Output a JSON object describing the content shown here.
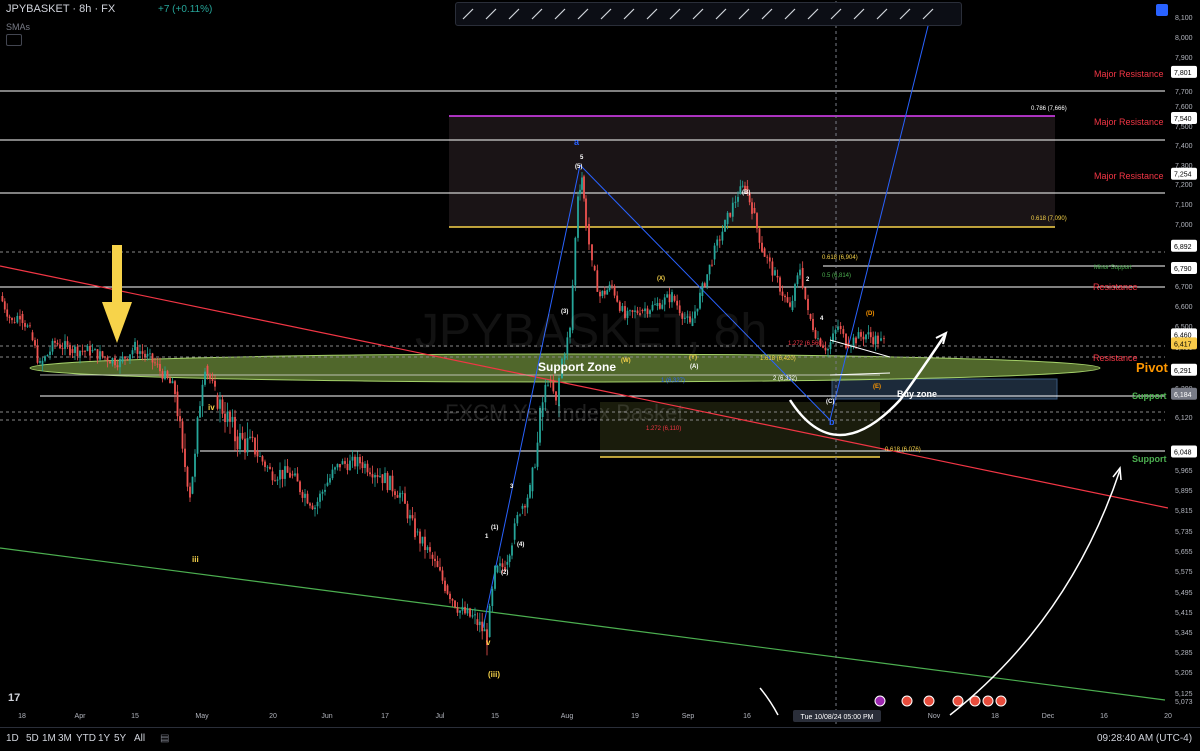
{
  "header": {
    "symbol": "JPYBASKET · 8h · FX",
    "change": "+7 (+0.11%)",
    "indicator": "SMAs"
  },
  "toolbar": {
    "icons": [
      "trend-line",
      "horizontal-line",
      "horizontal-ray",
      "vertical-line",
      "parallel-channel",
      "fib-retracement",
      "pitchfork",
      "elliott-wave",
      "xabcd-pattern",
      "abcd-pattern",
      "head-shoulders",
      "long-position",
      "range",
      "text",
      "rectangle",
      "circle",
      "path",
      "brush",
      "flag",
      "note",
      "ellipse"
    ]
  },
  "watermark": {
    "symbol": "JPYBASKET, 8h",
    "description": "FXCM Yen Index Basket"
  },
  "chart_data": {
    "type": "candlestick",
    "symbol": "JPYBASKET",
    "timeframe": "8h",
    "y_axis": {
      "ticks": [
        "8,100",
        "8,000",
        "7,900",
        "7,800",
        "7,700",
        "7,600",
        "7,500",
        "7,400",
        "7,300",
        "7,200",
        "7,100",
        "7,000",
        "6,900",
        "6,800",
        "6,700",
        "6,600",
        "6,500",
        "6,400",
        "6,300",
        "6,200",
        "6,120",
        "6,050",
        "5,965",
        "5,895",
        "5,815",
        "5,735",
        "5,655",
        "5,575",
        "5,495",
        "5,415",
        "5,345",
        "5,285",
        "5,205",
        "5,125",
        "5,073"
      ],
      "tick_values": [
        8100,
        8000,
        7900,
        7800,
        7700,
        7600,
        7500,
        7400,
        7300,
        7200,
        7100,
        7000,
        6900,
        6800,
        6700,
        6600,
        6500,
        6400,
        6300,
        6200,
        6120,
        6050,
        5965,
        5895,
        5815,
        5735,
        5655,
        5575,
        5495,
        5415,
        5345,
        5285,
        5205,
        5125,
        5073
      ],
      "badges": [
        {
          "text": "7,801",
          "value": 7801,
          "color": "#ffffff"
        },
        {
          "text": "7,540",
          "value": 7540,
          "color": "#ffffff"
        },
        {
          "text": "7,254",
          "value": 7254,
          "color": "#ffffff"
        },
        {
          "text": "6,892",
          "value": 6892,
          "color": "#ffffff"
        },
        {
          "text": "6,790",
          "value": 6790,
          "color": "#ffffff"
        },
        {
          "text": "6,460",
          "value": 6460,
          "color": "#ffffff"
        },
        {
          "text": "6,417",
          "value": 6417,
          "color": "#f7c948"
        },
        {
          "text": "6,291",
          "value": 6291,
          "color": "#ffffff"
        },
        {
          "text": "6,184",
          "value": 6184,
          "color": "#787b86"
        },
        {
          "text": "6,048",
          "value": 6048,
          "color": "#ffffff"
        }
      ]
    },
    "x_axis": {
      "ticks": [
        "18",
        "Apr",
        "15",
        "May",
        "20",
        "Jun",
        "17",
        "Jul",
        "15",
        "Aug",
        "19",
        "Sep",
        "16",
        "Nov",
        "18",
        "Dec",
        "16",
        "20"
      ],
      "crosshair_label": "Tue 10/08/24  05:00 PM"
    },
    "price_path": [
      [
        0,
        6650
      ],
      [
        12,
        6520
      ],
      [
        20,
        6560
      ],
      [
        30,
        6470
      ],
      [
        40,
        6310
      ],
      [
        55,
        6420
      ],
      [
        70,
        6390
      ],
      [
        90,
        6380
      ],
      [
        105,
        6350
      ],
      [
        120,
        6330
      ],
      [
        135,
        6400
      ],
      [
        155,
        6320
      ],
      [
        175,
        6190
      ],
      [
        190,
        5880
      ],
      [
        205,
        6310
      ],
      [
        215,
        6180
      ],
      [
        235,
        6080
      ],
      [
        255,
        6050
      ],
      [
        270,
        5960
      ],
      [
        290,
        5950
      ],
      [
        315,
        5830
      ],
      [
        325,
        5910
      ],
      [
        340,
        5990
      ],
      [
        360,
        6000
      ],
      [
        380,
        5950
      ],
      [
        400,
        5880
      ],
      [
        415,
        5730
      ],
      [
        430,
        5640
      ],
      [
        445,
        5520
      ],
      [
        460,
        5420
      ],
      [
        475,
        5390
      ],
      [
        487,
        5330
      ],
      [
        495,
        5570
      ],
      [
        505,
        5600
      ],
      [
        512,
        5700
      ],
      [
        520,
        5820
      ],
      [
        530,
        5890
      ],
      [
        540,
        6120
      ],
      [
        548,
        6240
      ],
      [
        556,
        6150
      ],
      [
        562,
        6340
      ],
      [
        570,
        6480
      ],
      [
        578,
        7150
      ],
      [
        582,
        7240
      ],
      [
        586,
        7000
      ],
      [
        592,
        6800
      ],
      [
        600,
        6650
      ],
      [
        612,
        6700
      ],
      [
        625,
        6540
      ],
      [
        640,
        6580
      ],
      [
        655,
        6600
      ],
      [
        672,
        6650
      ],
      [
        690,
        6500
      ],
      [
        700,
        6650
      ],
      [
        712,
        6830
      ],
      [
        725,
        7000
      ],
      [
        738,
        7150
      ],
      [
        745,
        7190
      ],
      [
        752,
        7080
      ],
      [
        762,
        6880
      ],
      [
        775,
        6750
      ],
      [
        790,
        6580
      ],
      [
        800,
        6790
      ],
      [
        808,
        6560
      ],
      [
        818,
        6440
      ],
      [
        828,
        6390
      ],
      [
        838,
        6500
      ],
      [
        846,
        6420
      ],
      [
        856,
        6440
      ],
      [
        866,
        6460
      ],
      [
        878,
        6430
      ],
      [
        884,
        6420
      ]
    ],
    "elliott_labels": [
      "iii",
      "iv",
      "v",
      "(iii)",
      "a",
      "b",
      "(5)",
      "(1)",
      "(2)",
      "(3)",
      "(4)",
      "(W)",
      "(X)",
      "(Y)",
      "(A)",
      "(B)",
      "(C)",
      "(D)",
      "(E)",
      "1",
      "2",
      "3",
      "4",
      "5"
    ],
    "fib_levels": [
      {
        "label": "0.786 (7,666)",
        "value": 7666
      },
      {
        "label": "0.618 (7,090)",
        "value": 7090
      },
      {
        "label": "0.618 (6,904)",
        "value": 6904
      },
      {
        "label": "0.5 (6,814)",
        "value": 6814
      },
      {
        "label": "1.272 (6,560)",
        "value": 6560
      },
      {
        "label": "1.618 (6,420)",
        "value": 6420
      },
      {
        "label": "2 (6,332)",
        "value": 6332
      },
      {
        "label": "1 (6,327)",
        "value": 6327
      },
      {
        "label": "1.272 (6,110)",
        "value": 6110
      },
      {
        "label": "0.618 (6,076)",
        "value": 6076
      }
    ],
    "zone_labels": [
      {
        "text": "Major Resistance",
        "color": "#f23645"
      },
      {
        "text": "Major Resistance",
        "color": "#f23645"
      },
      {
        "text": "Major Resistance",
        "color": "#f23645"
      },
      {
        "text": "Resistance",
        "color": "#f23645"
      },
      {
        "text": "Minor Support",
        "color": "#4caf50"
      },
      {
        "text": "Resistance",
        "color": "#f23645"
      },
      {
        "text": "Pivot",
        "color": "#ff9800"
      },
      {
        "text": "Support",
        "color": "#4caf50"
      },
      {
        "text": "Support",
        "color": "#4caf50"
      },
      {
        "text": "Support Zone",
        "color": "#ffffff"
      },
      {
        "text": "Buy zone",
        "color": "#ffffff"
      }
    ]
  },
  "bottom": {
    "timeframes": [
      "1D",
      "5D",
      "1M",
      "3M",
      "YTD",
      "1Y",
      "5Y",
      "All"
    ],
    "clock": "09:28:40 AM (UTC-4)"
  }
}
